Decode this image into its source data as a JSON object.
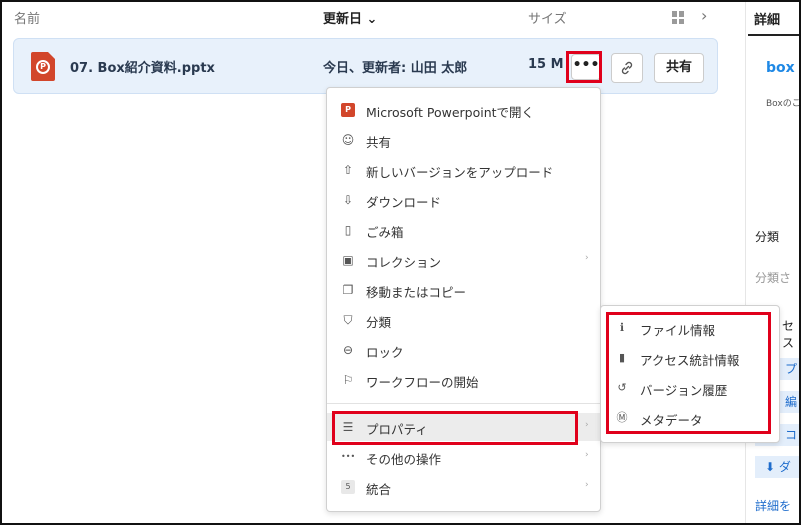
{
  "header": {
    "col_name": "名前",
    "col_date": "更新日",
    "col_date_sort": "⌄",
    "col_size": "サイズ",
    "nav_chevron": "›"
  },
  "file_row": {
    "name": "07. Box紹介資料.pptx",
    "updated": "今日、更新者: 山田 太郎",
    "size": "15 M",
    "more_label": "•••",
    "share_label": "共有",
    "icon_letter": "P"
  },
  "context_menu": {
    "items": [
      {
        "label": "Microsoft Powerpointで開く",
        "icon": "powerpoint-icon",
        "glyph": "P"
      },
      {
        "label": "共有",
        "icon": "share-user-icon",
        "glyph": "☺"
      },
      {
        "label": "新しいバージョンをアップロード",
        "icon": "upload-icon",
        "glyph": "⇧"
      },
      {
        "label": "ダウンロード",
        "icon": "download-icon",
        "glyph": "⇩"
      },
      {
        "label": "ごみ箱",
        "icon": "trash-icon",
        "glyph": "▯"
      },
      {
        "label": "コレクション",
        "icon": "collection-icon",
        "glyph": "▣"
      },
      {
        "label": "移動またはコピー",
        "icon": "copy-icon",
        "glyph": "❐"
      },
      {
        "label": "分類",
        "icon": "shield-icon",
        "glyph": "⛉"
      },
      {
        "label": "ロック",
        "icon": "lock-icon",
        "glyph": "⊖"
      },
      {
        "label": "ワークフローの開始",
        "icon": "workflow-flag-icon",
        "glyph": "⚐"
      },
      {
        "label": "プロパティ",
        "icon": "properties-icon",
        "glyph": "☰"
      },
      {
        "label": "その他の操作",
        "icon": "more-icon",
        "glyph": "•••"
      },
      {
        "label": "統合",
        "icon": "integration-icon",
        "glyph": "5"
      }
    ],
    "submenu_arrow": "›"
  },
  "submenu": {
    "items": [
      {
        "label": "ファイル情報",
        "icon": "file-info-icon",
        "glyph": "ℹ"
      },
      {
        "label": "アクセス統計情報",
        "icon": "stats-bar-icon",
        "glyph": "▮"
      },
      {
        "label": "バージョン履歴",
        "icon": "history-icon",
        "glyph": "↺"
      },
      {
        "label": "メタデータ",
        "icon": "metadata-icon",
        "glyph": "Ⓜ"
      }
    ]
  },
  "right_panel": {
    "title": "詳細",
    "logo": "box",
    "small_text": "Boxのこ",
    "classification": "分類",
    "classification_value": "分類さ",
    "security_label": "セス",
    "blue_1": "プ",
    "blue_2": "編",
    "blue_3": "コ",
    "blue_4": "⬇ ダ",
    "link": "詳細を"
  },
  "colors": {
    "row_bg": "#e8f1fb",
    "highlight": "#e0001b",
    "ppt_red": "#d2462b",
    "link_blue": "#1e6ccc"
  }
}
